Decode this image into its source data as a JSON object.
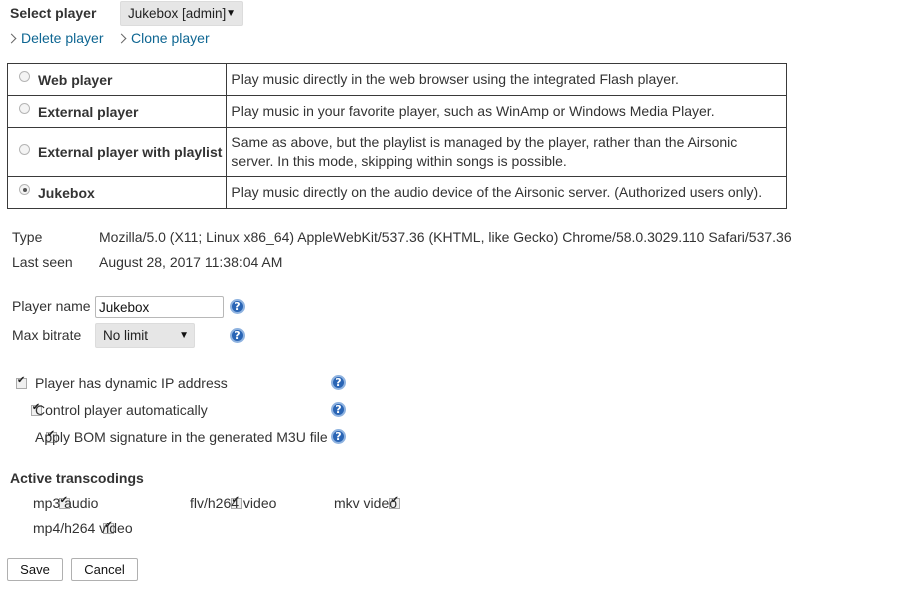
{
  "header": {
    "select_player_label": "Select player",
    "player_select_value": "Jukebox [admin]",
    "delete_link": "Delete player",
    "clone_link": "Clone player"
  },
  "modes": [
    {
      "label": "Web player",
      "description": "Play music directly in the web browser using the integrated Flash player.",
      "selected": false
    },
    {
      "label": "External player",
      "description": "Play music in your favorite player, such as WinAmp or Windows Media Player.",
      "selected": false
    },
    {
      "label": "External player with playlist",
      "description": "Same as above, but the playlist is managed by the player, rather than the Airsonic server. In this mode, skipping within songs is possible.",
      "selected": false
    },
    {
      "label": "Jukebox",
      "description": "Play music directly on the audio device of the Airsonic server. (Authorized users only).",
      "selected": true
    }
  ],
  "info": {
    "type_label": "Type",
    "type_value": "Mozilla/5.0 (X11; Linux x86_64) AppleWebKit/537.36 (KHTML, like Gecko) Chrome/58.0.3029.110 Safari/537.36",
    "last_seen_label": "Last seen",
    "last_seen_value": "August 28, 2017 11:38:04 AM"
  },
  "settings": {
    "player_name_label": "Player name",
    "player_name_value": "Jukebox",
    "max_bitrate_label": "Max bitrate",
    "max_bitrate_value": "No limit",
    "help_glyph": "?"
  },
  "options": [
    {
      "label": "Player has dynamic IP address",
      "checked": true
    },
    {
      "label": "Control player automatically",
      "checked": true
    },
    {
      "label": "Apply BOM signature in the generated M3U file",
      "checked": true
    }
  ],
  "transcodings": {
    "heading": "Active transcodings",
    "items": [
      {
        "label": "mp3 audio",
        "checked": true
      },
      {
        "label": "flv/h264 video",
        "checked": true
      },
      {
        "label": "mkv video",
        "checked": true
      },
      {
        "label": "mp4/h264 video",
        "checked": true
      }
    ]
  },
  "buttons": {
    "save": "Save",
    "cancel": "Cancel"
  },
  "colors": {
    "link": "#0e6692",
    "help_icon": "#2a65b5",
    "select_bg": "#e6e6e6"
  }
}
